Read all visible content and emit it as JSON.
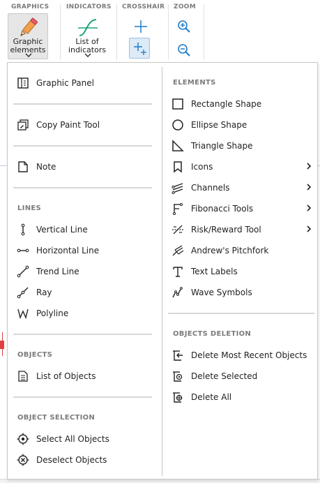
{
  "ribbon": {
    "groups": {
      "graphics": "GRAPHICS",
      "indicators": "INDICATORS",
      "crosshair": "CROSSHAIR",
      "zoom": "ZOOM"
    },
    "graphic_elements_label": "Graphic elements",
    "list_of_indicators_label": "List of indicators"
  },
  "menu": {
    "left": {
      "graphic_panel": "Graphic Panel",
      "copy_paint_tool": "Copy Paint Tool",
      "note": "Note",
      "lines_header": "LINES",
      "vertical_line": "Vertical Line",
      "horizontal_line": "Horizontal Line",
      "trend_line": "Trend Line",
      "ray": "Ray",
      "polyline": "Polyline",
      "objects_header": "OBJECTS",
      "list_of_objects": "List of Objects",
      "object_selection_header": "OBJECT SELECTION",
      "select_all_objects": "Select All Objects",
      "deselect_objects": "Deselect Objects"
    },
    "right": {
      "elements_header": "ELEMENTS",
      "rectangle_shape": "Rectangle Shape",
      "ellipse_shape": "Ellipse Shape",
      "triangle_shape": "Triangle Shape",
      "icons": "Icons",
      "channels": "Channels",
      "fibonacci_tools": "Fibonacci Tools",
      "risk_reward_tool": "Risk/Reward Tool",
      "andrews_pitchfork": "Andrew's Pitchfork",
      "text_labels": "Text Labels",
      "wave_symbols": "Wave Symbols",
      "objects_deletion_header": "OBJECTS DELETION",
      "delete_most_recent": "Delete Most Recent Objects",
      "delete_selected": "Delete Selected",
      "delete_all": "Delete All"
    }
  },
  "colors": {
    "accent": "#1f7bc9",
    "green": "#1aa37a",
    "pencil": "#e8873a"
  }
}
